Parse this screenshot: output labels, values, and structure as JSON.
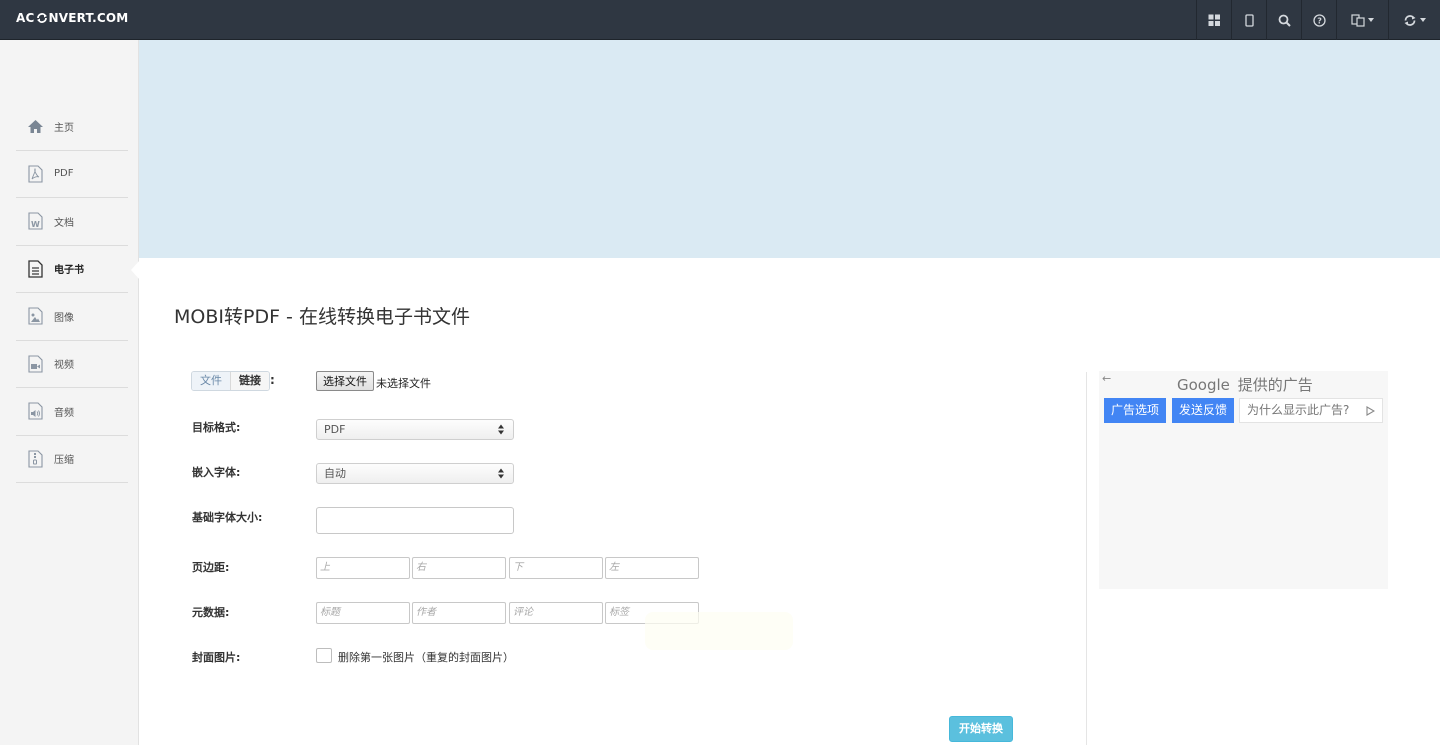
{
  "header": {
    "logo_text_pre": "AC",
    "logo_text_post": "NVERT.COM",
    "icons": [
      "grid-icon",
      "mobile-icon",
      "search-icon",
      "help-icon",
      "language-icon",
      "refresh-icon"
    ]
  },
  "sidebar": {
    "items": [
      {
        "label": "主页",
        "icon": "home-icon"
      },
      {
        "label": "PDF",
        "icon": "pdf-icon"
      },
      {
        "label": "文档",
        "icon": "document-icon"
      },
      {
        "label": "电子书",
        "icon": "ebook-icon",
        "active": true
      },
      {
        "label": "图像",
        "icon": "image-icon"
      },
      {
        "label": "视频",
        "icon": "video-icon"
      },
      {
        "label": "音频",
        "icon": "audio-icon"
      },
      {
        "label": "压缩",
        "icon": "archive-icon"
      }
    ]
  },
  "main": {
    "title": "MOBI转PDF - 在线转换电子书文件",
    "source_tabs": {
      "file": "文件",
      "link": "链接",
      "colon": ":"
    },
    "file_button": "选择文件",
    "file_status": "未选择文件",
    "fields": {
      "target_format": {
        "label": "目标格式:",
        "value": "PDF"
      },
      "embed_font": {
        "label": "嵌入字体:",
        "value": "自动"
      },
      "base_font_size": {
        "label": "基础字体大小:",
        "value": ""
      },
      "margins": {
        "label": "页边距:",
        "placeholders": [
          "上",
          "右",
          "下",
          "左"
        ]
      },
      "metadata": {
        "label": "元数据:",
        "placeholders": [
          "标题",
          "作者",
          "评论",
          "标签"
        ]
      },
      "cover": {
        "label": "封面图片:",
        "checkbox_label": "删除第一张图片（重复的封面图片）",
        "checked": false
      }
    },
    "convert_button": "开始转换"
  },
  "ad": {
    "back_arrow": "←",
    "provider": "Google",
    "provider_suffix": "提供的广告",
    "options_button": "广告选项",
    "feedback_button": "发送反馈",
    "why_button": "为什么显示此广告?"
  },
  "colors": {
    "topbar": "#2f3742",
    "banner": "#daeaf3",
    "convert": "#5bc0de",
    "ad_blue": "#4285f4"
  }
}
